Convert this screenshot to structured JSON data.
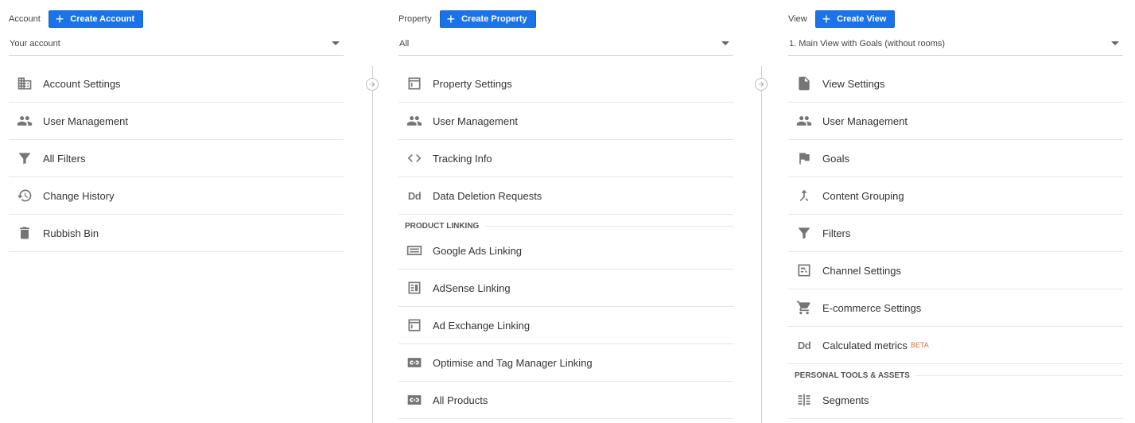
{
  "account": {
    "label": "Account",
    "create_label": "Create Account",
    "selected": "Your account",
    "items": [
      {
        "label": "Account Settings",
        "icon": "building-icon"
      },
      {
        "label": "User Management",
        "icon": "people-icon"
      },
      {
        "label": "All Filters",
        "icon": "filter-icon"
      },
      {
        "label": "Change History",
        "icon": "history-icon"
      },
      {
        "label": "Rubbish Bin",
        "icon": "trash-icon"
      }
    ]
  },
  "property": {
    "label": "Property",
    "create_label": "Create Property",
    "selected": "All",
    "items": [
      {
        "label": "Property Settings",
        "icon": "layout-icon"
      },
      {
        "label": "User Management",
        "icon": "people-icon"
      },
      {
        "label": "Tracking Info",
        "icon": "code-icon"
      },
      {
        "label": "Data Deletion Requests",
        "icon": "dd-icon",
        "glyph": "Dd"
      }
    ],
    "section_label": "PRODUCT LINKING",
    "linking_items": [
      {
        "label": "Google Ads Linking",
        "icon": "ads-icon"
      },
      {
        "label": "AdSense Linking",
        "icon": "adsense-icon"
      },
      {
        "label": "Ad Exchange Linking",
        "icon": "layout-icon"
      },
      {
        "label": "Optimise and Tag Manager Linking",
        "icon": "link-icon"
      },
      {
        "label": "All Products",
        "icon": "link-icon"
      }
    ]
  },
  "view": {
    "label": "View",
    "create_label": "Create View",
    "selected": "1. Main View with Goals (without rooms)",
    "items": [
      {
        "label": "View Settings",
        "icon": "document-icon"
      },
      {
        "label": "User Management",
        "icon": "people-icon"
      },
      {
        "label": "Goals",
        "icon": "flag-icon"
      },
      {
        "label": "Content Grouping",
        "icon": "merge-icon"
      },
      {
        "label": "Filters",
        "icon": "filter-icon"
      },
      {
        "label": "Channel Settings",
        "icon": "channel-icon"
      },
      {
        "label": "E-commerce Settings",
        "icon": "cart-icon"
      },
      {
        "label": "Calculated metrics",
        "icon": "dd-icon",
        "glyph": "Dd",
        "badge": "BETA"
      }
    ],
    "section_label": "PERSONAL TOOLS & ASSETS",
    "tools_items": [
      {
        "label": "Segments",
        "icon": "segments-icon"
      }
    ]
  },
  "colors": {
    "accent": "#1a73e8",
    "beta": "#e0703a",
    "icon": "#757575"
  }
}
